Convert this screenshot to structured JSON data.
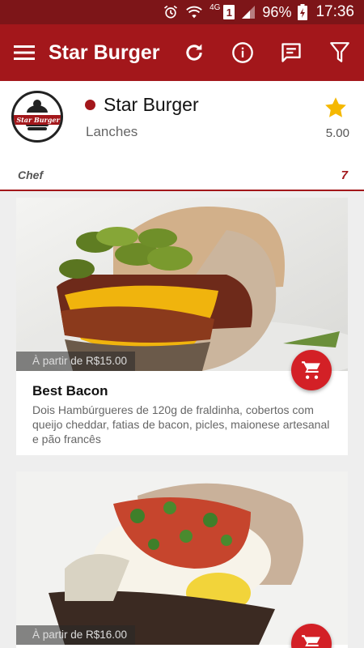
{
  "status_bar": {
    "network_label": "4G",
    "sim_label": "1",
    "battery": "96%",
    "time": "17:36"
  },
  "app_bar": {
    "title": "Star Burger",
    "icons": [
      "menu-icon",
      "refresh-icon",
      "info-icon",
      "feedback-icon",
      "filter-icon"
    ]
  },
  "store": {
    "logo_text": "Star Burger",
    "name": "Star Burger",
    "category": "Lanches",
    "rating": "5.00",
    "status_color": "#a3171b",
    "section_label": "Chef",
    "section_count": "7"
  },
  "products": [
    {
      "price": "À partir de R$15.00",
      "title": "Best Bacon",
      "description": "Dois Hambúrgueres de 120g de fraldinha, cobertos com queijo cheddar, fatias de bacon, picles, maionese artesanal e pão francês"
    },
    {
      "price": "À partir de R$16.00"
    }
  ],
  "colors": {
    "primary": "#a3171b",
    "primary_dark": "#7d1518",
    "fab": "#d32026",
    "star": "#f5b800"
  }
}
